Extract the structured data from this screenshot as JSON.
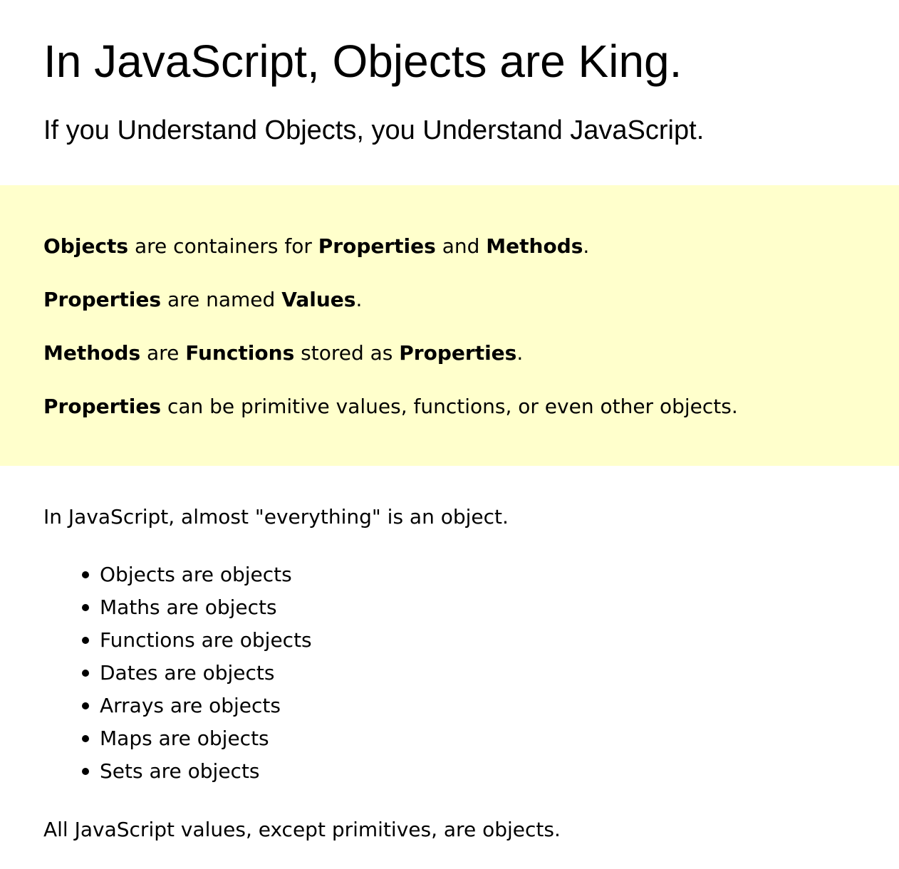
{
  "header": {
    "title": "In JavaScript, Objects are King.",
    "subtitle": "If you Understand Objects, you Understand JavaScript."
  },
  "note": {
    "line1": {
      "t1": "Objects",
      "t2": " are containers for ",
      "t3": "Properties",
      "t4": " and ",
      "t5": "Methods",
      "t6": "."
    },
    "line2": {
      "t1": "Properties",
      "t2": " are named ",
      "t3": "Values",
      "t4": "."
    },
    "line3": {
      "t1": "Methods",
      "t2": " are ",
      "t3": "Functions",
      "t4": " stored as ",
      "t5": "Properties",
      "t6": "."
    },
    "line4": {
      "t1": "Properties",
      "t2": " can be primitive values, functions, or even other objects."
    },
    "background_color": "#ffffcc"
  },
  "body": {
    "intro": "In JavaScript, almost \"everything\" is an object.",
    "list": [
      "Objects are objects",
      "Maths are objects",
      "Functions are objects",
      "Dates are objects",
      "Arrays are objects",
      "Maps are objects",
      "Sets are objects"
    ],
    "outro": "All JavaScript values, except primitives, are objects."
  }
}
